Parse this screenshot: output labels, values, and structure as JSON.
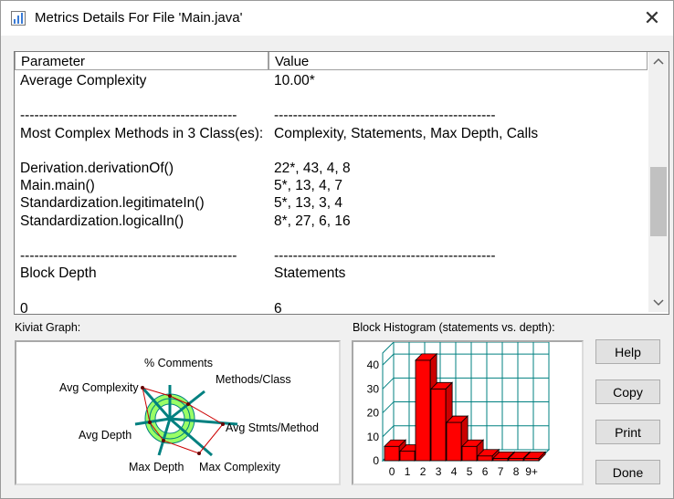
{
  "window": {
    "title": "Metrics Details For File 'Main.java'",
    "close_glyph": "✕"
  },
  "table": {
    "headers": {
      "parameter": "Parameter",
      "value": "Value"
    },
    "rows": [
      {
        "p": "Average Complexity",
        "v": "10.00*"
      },
      {
        "p": "",
        "v": ""
      },
      {
        "p": "----------------------------------------------",
        "v": "-----------------------------------------------"
      },
      {
        "p": "Most Complex Methods in 3 Class(es):",
        "v": "Complexity, Statements, Max Depth, Calls"
      },
      {
        "p": "",
        "v": ""
      },
      {
        "p": "Derivation.derivationOf()",
        "v": "22*, 43, 4, 8"
      },
      {
        "p": "Main.main()",
        "v": "5*, 13, 4, 7"
      },
      {
        "p": "Standardization.legitimateIn()",
        "v": "5*, 13, 3, 4"
      },
      {
        "p": "Standardization.logicalIn()",
        "v": "8*, 27, 6, 16"
      },
      {
        "p": "",
        "v": ""
      },
      {
        "p": "----------------------------------------------",
        "v": "-----------------------------------------------"
      },
      {
        "p": "Block Depth",
        "v": "Statements"
      },
      {
        "p": "",
        "v": ""
      },
      {
        "p": "0",
        "v": "6"
      }
    ]
  },
  "kiviat": {
    "label": "Kiviat Graph:",
    "axes": [
      "% Comments",
      "Methods/Class",
      "Avg Stmts/Method",
      "Max Complexity",
      "Max Depth",
      "Avg Depth",
      "Avg Complexity"
    ]
  },
  "histogram": {
    "label": "Block Histogram (statements vs. depth):"
  },
  "chart_data": {
    "type": "bar",
    "title": "Block Histogram (statements vs. depth):",
    "categories": [
      "0",
      "1",
      "2",
      "3",
      "4",
      "5",
      "6",
      "7",
      "8",
      "9+"
    ],
    "values": [
      6,
      4,
      42,
      30,
      16,
      6,
      2,
      1,
      1,
      1
    ],
    "ylim": [
      0,
      45
    ],
    "yticks": [
      0,
      10,
      20,
      30,
      40
    ],
    "grid": true
  },
  "buttons": {
    "help": "Help",
    "copy": "Copy",
    "print": "Print",
    "done": "Done"
  },
  "colors": {
    "bar": "#ff0000",
    "grid": "#008080",
    "kiviat_ring": "#99ff66",
    "kiviat_axes": "#008080",
    "kiviat_poly": "#cc0000"
  }
}
